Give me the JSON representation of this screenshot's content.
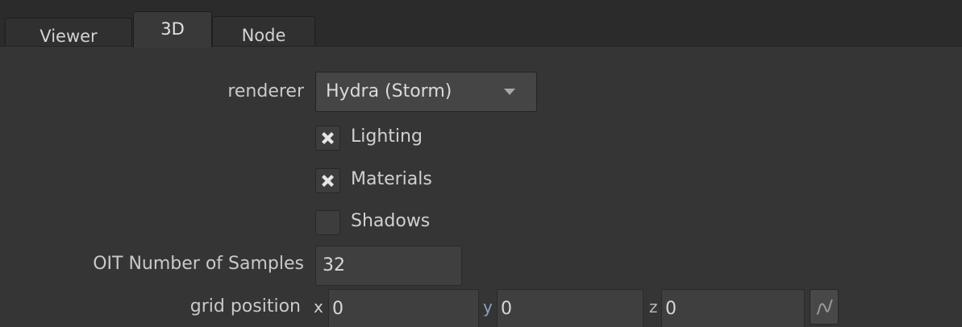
{
  "tabs": [
    {
      "label": "Viewer",
      "active": false
    },
    {
      "label": "3D",
      "active": true
    },
    {
      "label": "Node",
      "active": false
    }
  ],
  "renderer": {
    "label": "renderer",
    "value": "Hydra (Storm)",
    "icon": "chevron-down-icon"
  },
  "options": [
    {
      "label": "Lighting",
      "checked": true
    },
    {
      "label": "Materials",
      "checked": true
    },
    {
      "label": "Shadows",
      "checked": false
    }
  ],
  "oit": {
    "label": "OIT Number of Samples",
    "value": "32"
  },
  "grid": {
    "label": "grid position",
    "x_label": "x",
    "x_value": "0",
    "y_label": "y",
    "y_value": "0",
    "z_label": "z",
    "z_value": "0",
    "curve_icon": "animation-curve-icon"
  },
  "colors": {
    "panel": "#353535",
    "tabbar": "#2b2b2b",
    "field": "#3f3f3f",
    "check_mark": "#e6e6e6",
    "axis_x": "#d1d1d1",
    "axis_y": "#8aa4c4",
    "axis_z": "#b7b7b7"
  }
}
